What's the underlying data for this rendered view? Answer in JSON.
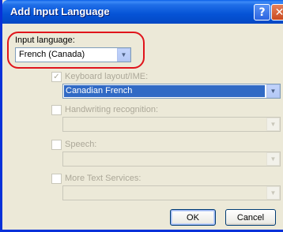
{
  "window": {
    "title": "Add Input Language"
  },
  "titlebar": {
    "help_glyph": "?",
    "close_glyph": "✕"
  },
  "input_language": {
    "label": "Input language:",
    "value": "French (Canada)"
  },
  "keyboard_layout": {
    "label": "Keyboard layout/IME:",
    "checked": true,
    "value": "Canadian French"
  },
  "handwriting": {
    "label": "Handwriting recognition:",
    "checked": false,
    "value": ""
  },
  "speech": {
    "label": "Speech:",
    "checked": false,
    "value": ""
  },
  "text_services": {
    "label": "More Text Services:",
    "checked": false,
    "value": ""
  },
  "buttons": {
    "ok": "OK",
    "cancel": "Cancel"
  },
  "icons": {
    "check": "✓",
    "dropdown": "▼"
  },
  "colors": {
    "titlebar": "#0553d6",
    "highlight_ring": "#e0141b",
    "selection": "#316ac5"
  }
}
